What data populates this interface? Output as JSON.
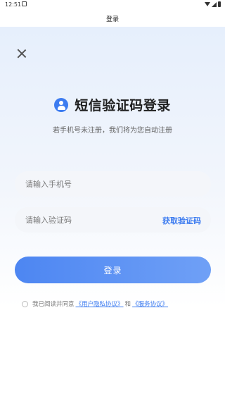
{
  "status_bar": {
    "time": "12:51"
  },
  "header": {
    "title": "登录"
  },
  "heading": {
    "title": "短信验证码登录",
    "subtitle": "若手机号未注册，我们将为您自动注册"
  },
  "form": {
    "phone_placeholder": "请输入手机号",
    "code_placeholder": "请输入验证码",
    "get_code_label": "获取验证码",
    "login_label": "登录"
  },
  "agreement": {
    "prefix": "我已阅读并同意",
    "user_agreement": "《用户隐私协议》",
    "conjunction": "和",
    "service_agreement": "《服务协议》"
  },
  "colors": {
    "accent": "#3d7cf0"
  }
}
